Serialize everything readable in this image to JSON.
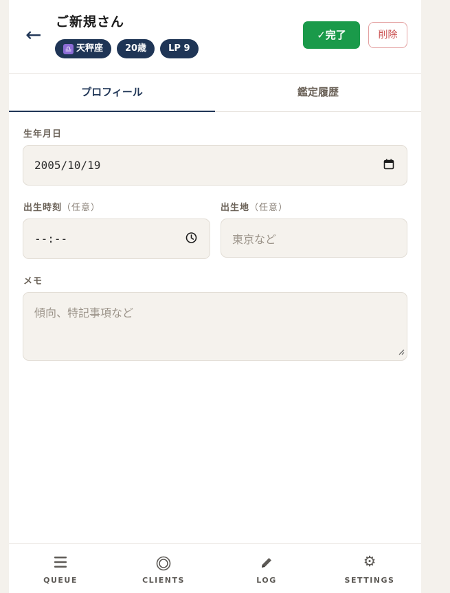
{
  "header": {
    "back_icon": "arrow-left-icon",
    "client_name": "ご新規さん",
    "badges": [
      {
        "icon": "libra-icon",
        "label": "天秤座"
      },
      {
        "label": "20歳"
      },
      {
        "label": "LP 9"
      }
    ],
    "done_label": "✓完了",
    "delete_label": "削除"
  },
  "tabs": [
    {
      "label": "プロフィール",
      "active": true
    },
    {
      "label": "鑑定履歴",
      "active": false
    }
  ],
  "form": {
    "birthdate": {
      "label": "生年月日",
      "value": "2005/10/19",
      "icon": "calendar-icon"
    },
    "birthtime": {
      "label": "出生時刻",
      "optional": "（任意）",
      "value": "--:--",
      "icon": "clock-icon"
    },
    "birthplace": {
      "label": "出生地",
      "optional": "（任意）",
      "placeholder": "東京など"
    },
    "memo": {
      "label": "メモ",
      "placeholder": "傾向、特記事項など"
    }
  },
  "bottom_nav": [
    {
      "label": "QUEUE",
      "icon": "list-icon"
    },
    {
      "label": "CLIENTS",
      "icon": "circle-icon"
    },
    {
      "label": "LOG",
      "icon": "pencil-icon"
    },
    {
      "label": "SETTINGS",
      "icon": "gear-icon"
    }
  ],
  "colors": {
    "navy": "#1f3556",
    "done_green": "#1a9a4a",
    "delete_red": "#c94b4b",
    "field_bg": "#f5f2ed",
    "page_bg": "#f4f1ec"
  }
}
